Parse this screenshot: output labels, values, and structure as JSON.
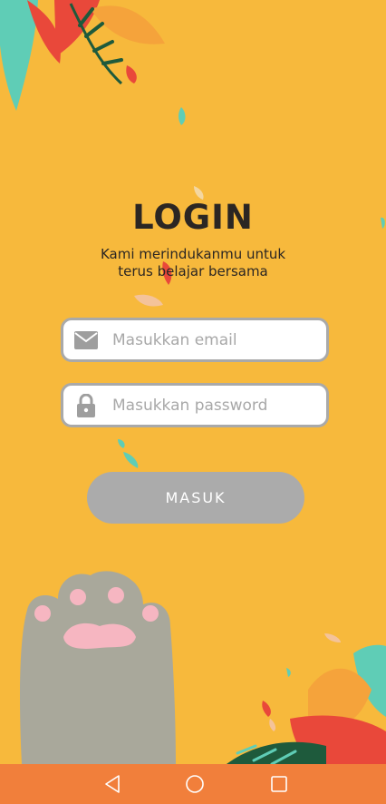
{
  "login": {
    "title": "LOGIN",
    "subtitle": "Kami merindukanmu untuk terus belajar bersama",
    "email_placeholder": "Masukkan email",
    "password_placeholder": "Masukkan password",
    "submit_label": "MASUK"
  },
  "icons": {
    "email": "envelope-icon",
    "password": "lock-icon",
    "nav_back": "triangle-back-icon",
    "nav_home": "circle-home-icon",
    "nav_recent": "square-recent-icon"
  },
  "colors": {
    "background": "#F7B93C",
    "field_border": "#A9A9A9",
    "button": "#ABABAB",
    "navbar": "#F17F3B",
    "title_text": "#2B2623"
  }
}
